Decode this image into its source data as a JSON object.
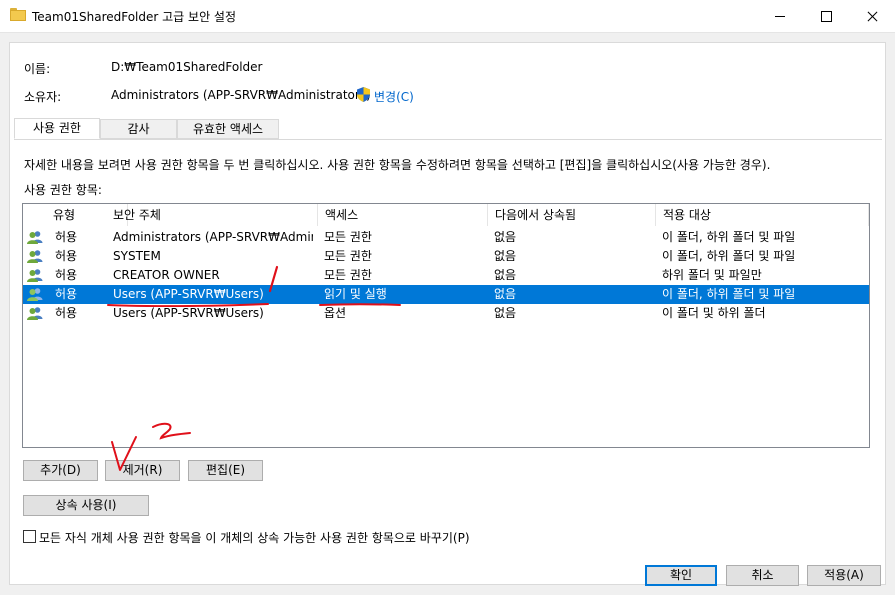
{
  "window": {
    "title": "Team01SharedFolder 고급 보안 설정"
  },
  "info": {
    "name_label": "이름:",
    "name_value": "D:₩Team01SharedFolder",
    "owner_label": "소유자:",
    "owner_value": "Administrators (APP-SRVR₩Administrators)",
    "change_link": "변경(C)"
  },
  "tabs": [
    {
      "label": "사용 권한",
      "active": true
    },
    {
      "label": "감사",
      "active": false
    },
    {
      "label": "유효한 액세스",
      "active": false
    }
  ],
  "description": "자세한 내용을 보려면 사용 권한 항목을 두 번 클릭하십시오. 사용 권한 항목을 수정하려면 항목을 선택하고 [편집]을 클릭하십시오(사용 가능한 경우).",
  "list_label": "사용 권한 항목:",
  "columns": [
    "유형",
    "보안 주체",
    "액세스",
    "다음에서 상속됨",
    "적용 대상"
  ],
  "rows": [
    {
      "type": "허용",
      "principal": "Administrators (APP-SRVR₩Admini...",
      "access": "모든 권한",
      "inherited": "없음",
      "applies": "이 폴더, 하위 폴더 및 파일",
      "selected": false
    },
    {
      "type": "허용",
      "principal": "SYSTEM",
      "access": "모든 권한",
      "inherited": "없음",
      "applies": "이 폴더, 하위 폴더 및 파일",
      "selected": false
    },
    {
      "type": "허용",
      "principal": "CREATOR OWNER",
      "access": "모든 권한",
      "inherited": "없음",
      "applies": "하위 폴더 및 파일만",
      "selected": false
    },
    {
      "type": "허용",
      "principal": "Users (APP-SRVR₩Users)",
      "access": "읽기 및 실행",
      "inherited": "없음",
      "applies": "이 폴더, 하위 폴더 및 파일",
      "selected": true
    },
    {
      "type": "허용",
      "principal": "Users (APP-SRVR₩Users)",
      "access": "옵션",
      "inherited": "없음",
      "applies": "이 폴더 및 하위 폴더",
      "selected": false
    }
  ],
  "buttons": {
    "add": "추가(D)",
    "remove": "제거(R)",
    "edit": "편집(E)",
    "inherit": "상속 사용(I)",
    "ok": "확인",
    "cancel": "취소",
    "apply": "적용(A)"
  },
  "replace_checkbox": {
    "label": "모든 자식 개체 사용 권한 항목을 이 개체의 상속 가능한 사용 권한 항목으로 바꾸기(P)",
    "checked": false
  },
  "colors": {
    "selection": "#0078d7",
    "link": "#0066cc",
    "annotation": "#e0101a"
  }
}
